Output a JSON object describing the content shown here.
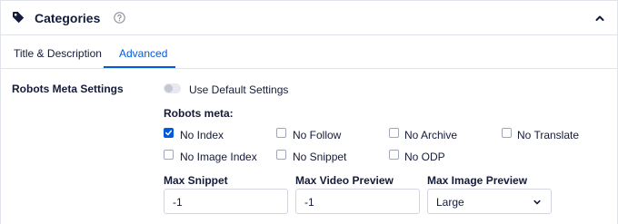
{
  "header": {
    "title": "Categories",
    "icon": "tag-icon",
    "help_icon": "help-icon",
    "collapse_icon": "chevron-up-icon"
  },
  "tabs": [
    {
      "label": "Title & Description",
      "active": false
    },
    {
      "label": "Advanced",
      "active": true
    }
  ],
  "accent_color": "#005ae0",
  "robots": {
    "section_label": "Robots Meta Settings",
    "use_default_label": "Use Default Settings",
    "use_default_on": false,
    "meta_label": "Robots meta:",
    "options": [
      {
        "label": "No Index",
        "checked": true
      },
      {
        "label": "No Follow",
        "checked": false
      },
      {
        "label": "No Archive",
        "checked": false
      },
      {
        "label": "No Translate",
        "checked": false
      },
      {
        "label": "No Image Index",
        "checked": false
      },
      {
        "label": "No Snippet",
        "checked": false
      },
      {
        "label": "No ODP",
        "checked": false
      }
    ]
  },
  "fields": {
    "max_snippet": {
      "label": "Max Snippet",
      "value": "-1"
    },
    "max_video_preview": {
      "label": "Max Video Preview",
      "value": "-1"
    },
    "max_image_preview": {
      "label": "Max Image Preview",
      "value": "Large"
    }
  }
}
